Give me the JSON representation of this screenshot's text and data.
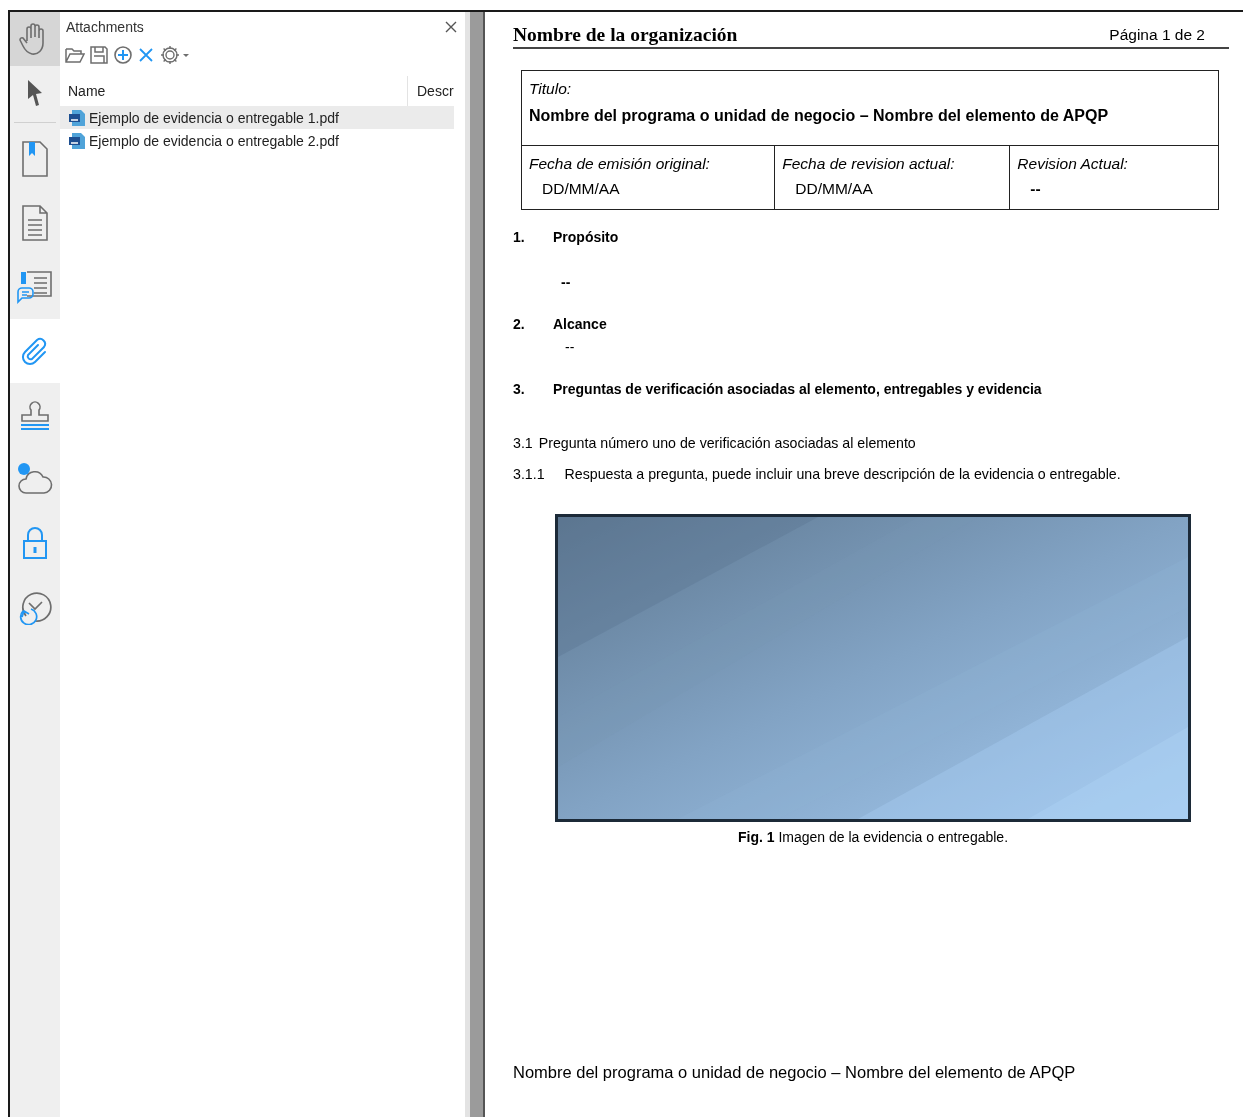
{
  "tools": [
    {
      "kind": "hand",
      "selected": true
    },
    {
      "kind": "select",
      "selected": false
    }
  ],
  "panels": [
    {
      "kind": "bookmarks",
      "selected": false
    },
    {
      "kind": "pages",
      "selected": false
    },
    {
      "kind": "comments",
      "selected": false
    },
    {
      "kind": "attachments",
      "selected": true
    },
    {
      "kind": "stamp",
      "selected": false
    },
    {
      "kind": "cloud",
      "selected": false
    },
    {
      "kind": "security",
      "selected": false
    },
    {
      "kind": "history",
      "selected": false
    }
  ],
  "attachments_panel": {
    "title": "Attachments",
    "columns": [
      "Name",
      "Descr"
    ],
    "files": [
      {
        "name": "Ejemplo de evidencia o entregable 1.pdf",
        "selected": true
      },
      {
        "name": "Ejemplo de evidencia o entregable 2.pdf",
        "selected": false
      }
    ]
  },
  "document": {
    "organization": "Nombre de la organización",
    "page": "Página 1 de 2",
    "title_label": "Titulo:",
    "title": "Nombre del programa o unidad de negocio – Nombre del elemento de APQP",
    "dates": [
      {
        "label": "Fecha de emisión original:",
        "value": "DD/MM/AA"
      },
      {
        "label": "Fecha de revision actual:",
        "value": "DD/MM/AA"
      },
      {
        "label": "Revision Actual:",
        "value": "--"
      }
    ],
    "sections": [
      {
        "number": "1.",
        "heading": "Propósito",
        "body": "--"
      },
      {
        "number": "2.",
        "heading": "Alcance",
        "body": "--"
      },
      {
        "number": "3.",
        "heading": "Preguntas de verificación asociadas al elemento, entregables y evidencia"
      }
    ],
    "subsections": [
      {
        "number": "3.1",
        "text": "Pregunta número uno de verificación asociadas al elemento"
      },
      {
        "number": "3.1.1",
        "text": "Respuesta a pregunta, puede incluir una breve descripción de la evidencia o entregable."
      }
    ],
    "figure": {
      "kind": "picture",
      "caption": "**Fig. 1** Imagen de la evidencia o entregable."
    },
    "footer": "Nombre del programa o unidad de negocio – Nombre del elemento de APQP"
  }
}
